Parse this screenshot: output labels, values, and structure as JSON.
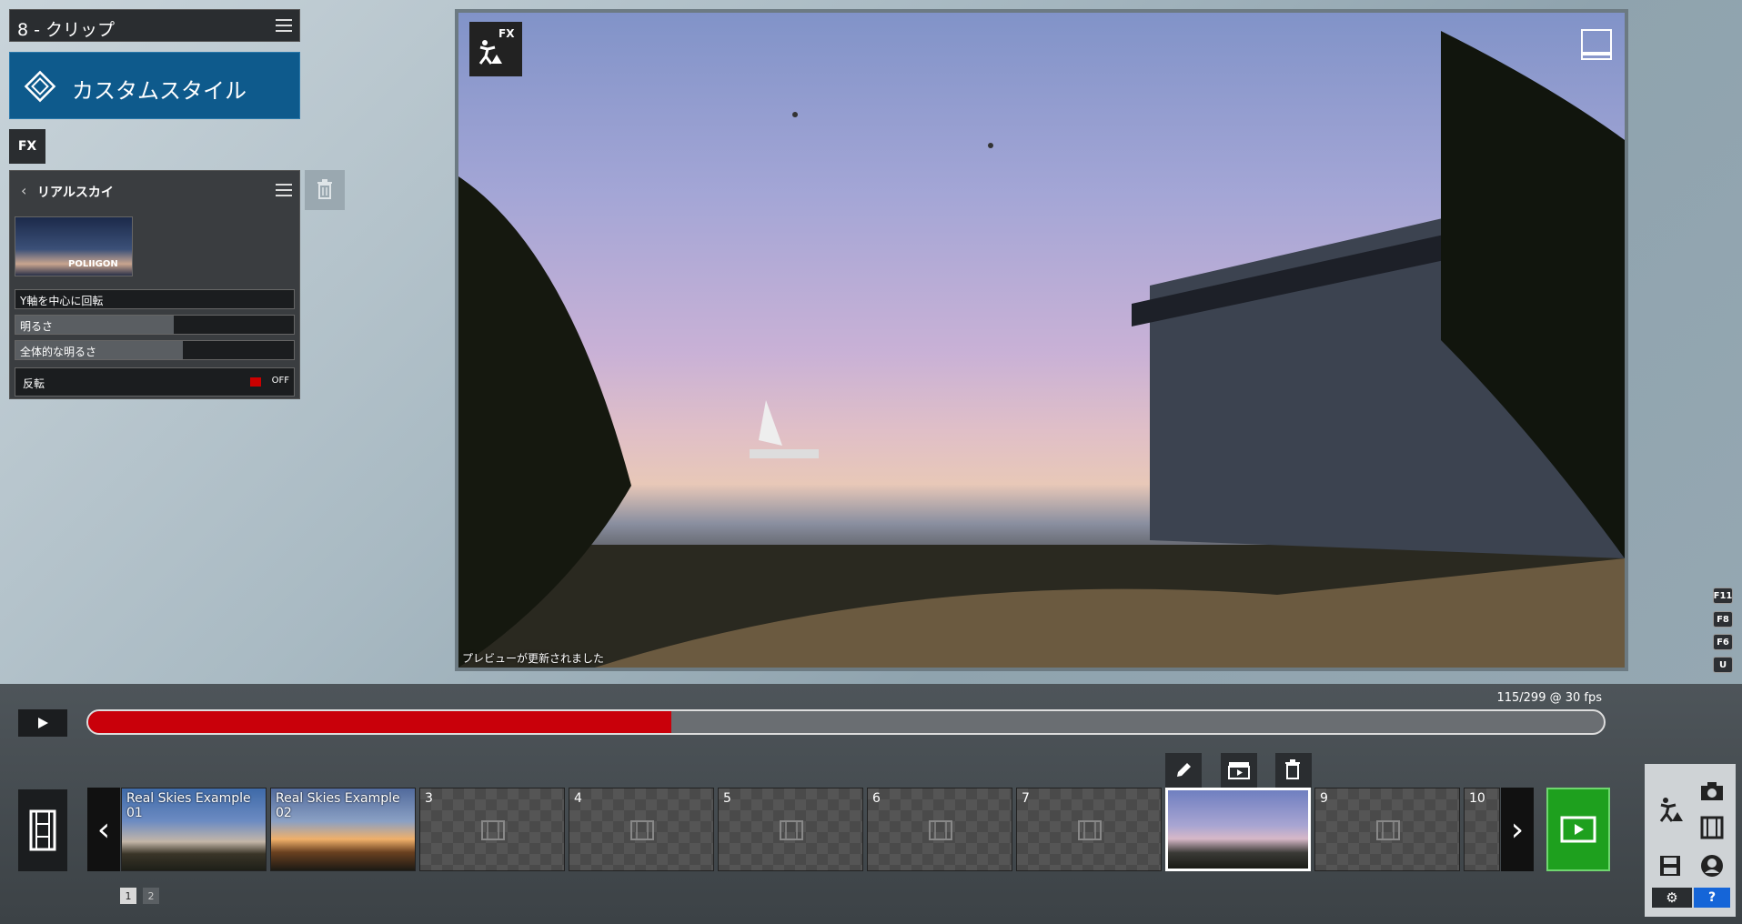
{
  "clip_header": {
    "title": "8 - クリップ"
  },
  "custom_style": {
    "label": "カスタムスタイル"
  },
  "fx_chip": {
    "label": "FX"
  },
  "fx_panel": {
    "title": "リアルスカイ",
    "thumbnail_brand": "POLIIGON",
    "sliders": [
      {
        "label": "Y軸を中心に回転",
        "value": 0.0
      },
      {
        "label": "明るさ",
        "value": 0.57
      },
      {
        "label": "全体的な明るさ",
        "value": 0.6
      }
    ],
    "toggle": {
      "label": "反転",
      "state": "OFF"
    }
  },
  "preview": {
    "badge_label": "FX",
    "status": "プレビューが更新されました"
  },
  "shortcut_keys": [
    "F11",
    "F8",
    "F6",
    "U"
  ],
  "timeline": {
    "frame_counter": "115/299 @ 30 fps",
    "progress": 0.385,
    "progress_color": "#c9000a"
  },
  "clips": [
    {
      "num": "",
      "title": "Real Skies Example 01",
      "thumb": "img1"
    },
    {
      "num": "",
      "title": "Real Skies Example 02",
      "thumb": "img2"
    },
    {
      "num": "3",
      "title": "",
      "thumb": "empty"
    },
    {
      "num": "4",
      "title": "",
      "thumb": "empty"
    },
    {
      "num": "5",
      "title": "",
      "thumb": "empty"
    },
    {
      "num": "6",
      "title": "",
      "thumb": "empty"
    },
    {
      "num": "7",
      "title": "",
      "thumb": "empty"
    },
    {
      "num": "",
      "title": "",
      "thumb": "img8"
    },
    {
      "num": "9",
      "title": "",
      "thumb": "empty"
    },
    {
      "num": "10",
      "title": "",
      "thumb": "empty"
    }
  ],
  "pages": [
    "1",
    "2"
  ],
  "colors": {
    "accent_blue": "#0e5a8c",
    "render_green": "#1ea01e",
    "progress_red": "#c9000a"
  },
  "icons": [
    "menu-icon",
    "custom-style-icon",
    "back-chevron-icon",
    "trash-icon",
    "construction-icon",
    "pencil-icon",
    "clapper-icon",
    "film-icon",
    "play-icon",
    "camera-icon",
    "save-icon",
    "gear-icon",
    "help-icon",
    "portrait-icon"
  ],
  "right_panel": {
    "help_label": "?"
  }
}
